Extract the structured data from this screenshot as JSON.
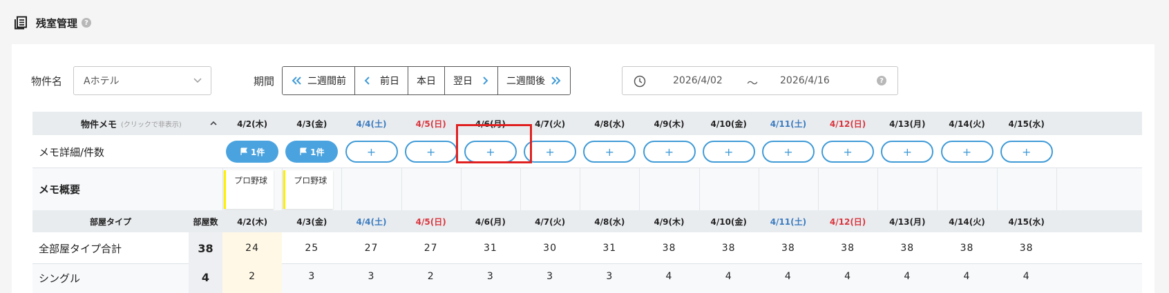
{
  "header": {
    "title": "残室管理",
    "help": "?"
  },
  "filters": {
    "property_label": "物件名",
    "property_value": "Aホテル",
    "period_label": "期間",
    "nav_buttons": [
      {
        "label": "二週間前",
        "icon": "double-chevron-left-icon"
      },
      {
        "label": "前日",
        "icon": "chevron-left-icon"
      },
      {
        "label": "本日",
        "icon": ""
      },
      {
        "label": "翌日",
        "icon": "chevron-right-icon"
      },
      {
        "label": "二週間後",
        "icon": "double-chevron-right-icon"
      }
    ],
    "date_from": "2026/4/02",
    "date_sep": "〜",
    "date_to": "2026/4/16",
    "date_help": "?"
  },
  "colors": {
    "accent": "#3f9ad6",
    "saturday": "#3b7bbf",
    "sunday": "#d9363e",
    "note_bar": "#ffef00",
    "highlight": "#e02020"
  },
  "dates": [
    {
      "label": "4/2(木)",
      "kind": "weekday"
    },
    {
      "label": "4/3(金)",
      "kind": "weekday"
    },
    {
      "label": "4/4(土)",
      "kind": "sat"
    },
    {
      "label": "4/5(日)",
      "kind": "sun"
    },
    {
      "label": "4/6(月)",
      "kind": "weekday"
    },
    {
      "label": "4/7(火)",
      "kind": "weekday"
    },
    {
      "label": "4/8(水)",
      "kind": "weekday"
    },
    {
      "label": "4/9(木)",
      "kind": "weekday"
    },
    {
      "label": "4/10(金)",
      "kind": "weekday"
    },
    {
      "label": "4/11(土)",
      "kind": "sat"
    },
    {
      "label": "4/12(日)",
      "kind": "sun"
    },
    {
      "label": "4/13(月)",
      "kind": "weekday"
    },
    {
      "label": "4/14(火)",
      "kind": "weekday"
    },
    {
      "label": "4/15(水)",
      "kind": "weekday"
    }
  ],
  "memo": {
    "header_label": "物件メモ",
    "header_hint": "(クリックで非表示)",
    "detail_label": "メモ詳細/件数",
    "summary_label": "メモ概要",
    "add_label": "+",
    "counts": [
      "1件",
      "1件",
      "",
      "",
      "",
      "",
      "",
      "",
      "",
      "",
      "",
      "",
      "",
      ""
    ],
    "summaries": [
      "プロ野球",
      "プロ野球",
      "",
      "",
      "",
      "",
      "",
      "",
      "",
      "",
      "",
      "",
      "",
      ""
    ]
  },
  "rooms": {
    "type_header": "部屋タイプ",
    "count_header": "部屋数",
    "rows": [
      {
        "name": "全部屋タイプ合計",
        "count": "38",
        "values": [
          "24",
          "25",
          "27",
          "27",
          "31",
          "30",
          "31",
          "38",
          "38",
          "38",
          "38",
          "38",
          "38",
          "38"
        ]
      },
      {
        "name": "シングル",
        "count": "4",
        "values": [
          "2",
          "3",
          "3",
          "2",
          "3",
          "3",
          "3",
          "4",
          "4",
          "4",
          "4",
          "4",
          "4",
          "4"
        ]
      }
    ]
  }
}
